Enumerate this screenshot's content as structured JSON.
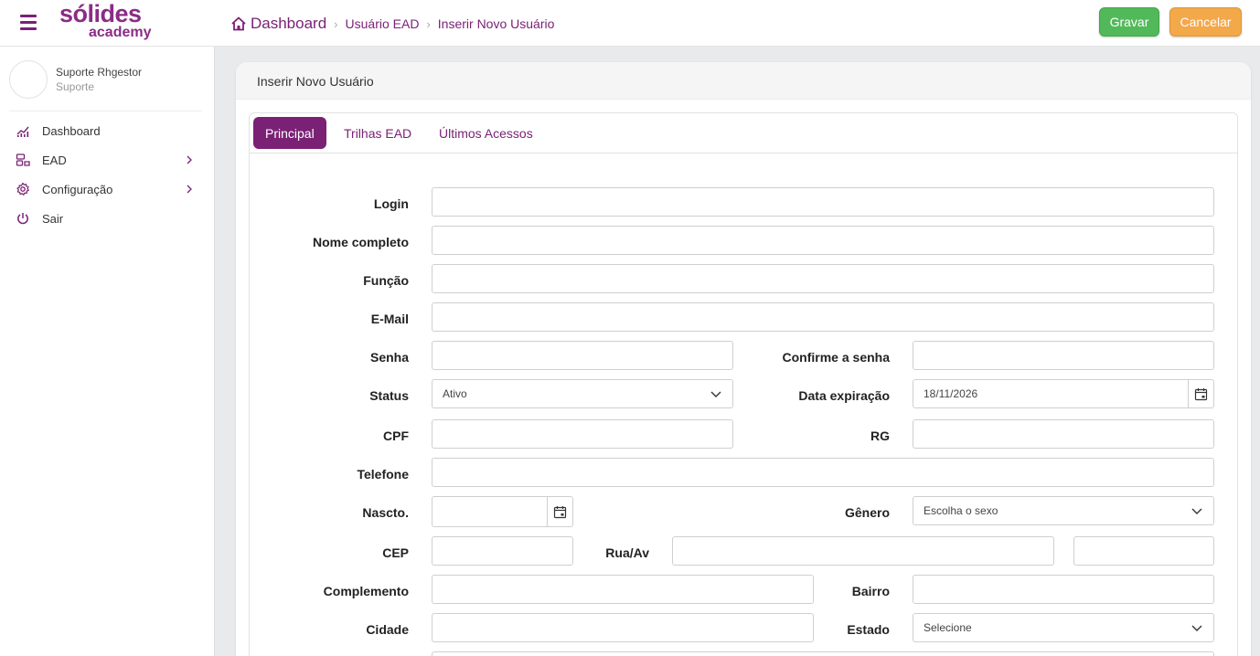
{
  "brand": {
    "logo_top": "sólides",
    "logo_bottom": "academy",
    "accent": "#7a2175"
  },
  "breadcrumb": {
    "home": "Dashboard",
    "level2": "Usuário EAD",
    "level3": "Inserir Novo Usuário"
  },
  "actions": {
    "save": "Gravar",
    "cancel": "Cancelar"
  },
  "user": {
    "name": "Suporte Rhgestor",
    "role": "Suporte"
  },
  "sidebar": {
    "items": [
      {
        "label": "Dashboard",
        "icon": "chart-icon"
      },
      {
        "label": "EAD",
        "icon": "ead-icon"
      },
      {
        "label": "Configuração",
        "icon": "gear-icon"
      },
      {
        "label": "Sair",
        "icon": "power-icon"
      }
    ]
  },
  "page": {
    "title": "Inserir Novo Usuário"
  },
  "tabs": [
    "Principal",
    "Trilhas EAD",
    "Últimos Acessos"
  ],
  "form": {
    "login": {
      "label": "Login",
      "value": ""
    },
    "nome": {
      "label": "Nome completo",
      "value": ""
    },
    "funcao": {
      "label": "Função",
      "value": ""
    },
    "email": {
      "label": "E-Mail",
      "value": ""
    },
    "senha": {
      "label": "Senha",
      "value": ""
    },
    "confirme": {
      "label": "Confirme a senha",
      "value": ""
    },
    "status": {
      "label": "Status",
      "value": "Ativo"
    },
    "expiracao": {
      "label": "Data expiração",
      "value": "18/11/2026"
    },
    "cpf": {
      "label": "CPF",
      "value": ""
    },
    "rg": {
      "label": "RG",
      "value": ""
    },
    "telefone": {
      "label": "Telefone",
      "value": ""
    },
    "nascto": {
      "label": "Nascto.",
      "value": ""
    },
    "genero": {
      "label": "Gênero",
      "value": "Escolha o sexo"
    },
    "cep": {
      "label": "CEP",
      "value": ""
    },
    "rua": {
      "label": "Rua/Av",
      "value": ""
    },
    "numero": {
      "value": ""
    },
    "complemento": {
      "label": "Complemento",
      "value": ""
    },
    "bairro": {
      "label": "Bairro",
      "value": ""
    },
    "cidade": {
      "label": "Cidade",
      "value": ""
    },
    "estado": {
      "label": "Estado",
      "value": "Selecione"
    }
  }
}
